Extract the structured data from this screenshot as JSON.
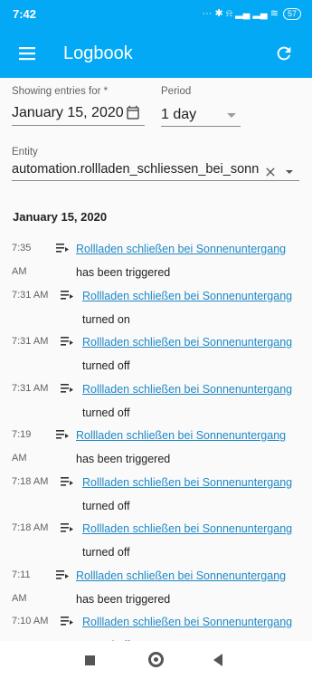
{
  "status": {
    "time": "7:42",
    "icons": "··· ✱ ⍾ ▂▄ ▂▄ ≋",
    "battery": "57"
  },
  "header": {
    "title": "Logbook"
  },
  "filters": {
    "date_label": "Showing entries for *",
    "date_value": "January 15, 2020",
    "period_label": "Period",
    "period_value": "1 day",
    "entity_label": "Entity",
    "entity_value": "automation.rollladen_schliessen_bei_sonn"
  },
  "section_date": "January 15, 2020",
  "entries": [
    {
      "time_a": "7:35",
      "time_b": "AM",
      "name": "Rollladen schließen bei Sonnenuntergang",
      "message": "has been triggered"
    },
    {
      "time_a": "7:31 AM",
      "time_b": "",
      "name": "Rollladen schließen bei Sonnenuntergang",
      "message": "turned on"
    },
    {
      "time_a": "7:31 AM",
      "time_b": "",
      "name": "Rollladen schließen bei Sonnenuntergang",
      "message": "turned off"
    },
    {
      "time_a": "7:31 AM",
      "time_b": "",
      "name": "Rollladen schließen bei Sonnenuntergang",
      "message": "turned off"
    },
    {
      "time_a": "7:19",
      "time_b": "AM",
      "name": "Rollladen schließen bei Sonnenuntergang",
      "message": "has been triggered"
    },
    {
      "time_a": "7:18 AM",
      "time_b": "",
      "name": "Rollladen schließen bei Sonnenuntergang",
      "message": "turned off"
    },
    {
      "time_a": "7:18 AM",
      "time_b": "",
      "name": "Rollladen schließen bei Sonnenuntergang",
      "message": "turned off"
    },
    {
      "time_a": "7:11",
      "time_b": "AM",
      "name": "Rollladen schließen bei Sonnenuntergang",
      "message": "has been triggered"
    },
    {
      "time_a": "7:10 AM",
      "time_b": "",
      "name": "Rollladen schließen bei Sonnenuntergang",
      "message": "turned off"
    }
  ],
  "colors": {
    "accent": "#03a9f4",
    "link": "#1e88c7"
  },
  "icons": [
    "menu-icon",
    "refresh-icon",
    "calendar-icon",
    "dropdown-arrow-icon",
    "clear-icon",
    "list-icon"
  ]
}
